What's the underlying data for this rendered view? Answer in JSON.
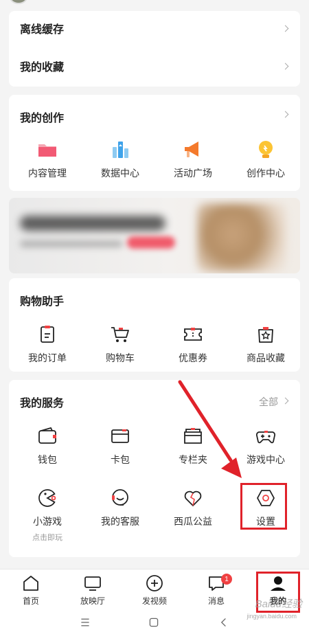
{
  "list_card": {
    "offline_cache": "离线缓存",
    "favorites": "我的收藏"
  },
  "creation": {
    "title": "我的创作",
    "items": [
      {
        "label": "内容管理",
        "icon": "folder-icon"
      },
      {
        "label": "数据中心",
        "icon": "bar-chart-icon"
      },
      {
        "label": "活动广场",
        "icon": "megaphone-icon"
      },
      {
        "label": "创作中心",
        "icon": "lightbulb-icon"
      }
    ]
  },
  "shopping": {
    "title": "购物助手",
    "items": [
      {
        "label": "我的订单",
        "icon": "order-icon"
      },
      {
        "label": "购物车",
        "icon": "cart-icon"
      },
      {
        "label": "优惠券",
        "icon": "coupon-icon"
      },
      {
        "label": "商品收藏",
        "icon": "bag-star-icon"
      }
    ]
  },
  "services": {
    "title": "我的服务",
    "more": "全部",
    "items": [
      {
        "label": "钱包",
        "icon": "wallet-icon"
      },
      {
        "label": "卡包",
        "icon": "card-icon"
      },
      {
        "label": "专栏夹",
        "icon": "column-folder-icon"
      },
      {
        "label": "游戏中心",
        "icon": "gamepad-icon"
      },
      {
        "label": "小游戏",
        "sub": "点击即玩",
        "icon": "pacman-icon"
      },
      {
        "label": "我的客服",
        "icon": "headset-icon"
      },
      {
        "label": "西瓜公益",
        "icon": "heart-icon"
      },
      {
        "label": "设置",
        "icon": "settings-hexagon-icon"
      }
    ]
  },
  "tabbar": {
    "items": [
      {
        "label": "首页",
        "icon": "home-icon"
      },
      {
        "label": "放映厅",
        "icon": "tv-icon"
      },
      {
        "label": "发视频",
        "icon": "plus-circle-icon"
      },
      {
        "label": "消息",
        "icon": "message-icon",
        "badge": "1"
      },
      {
        "label": "我的",
        "icon": "profile-icon"
      }
    ]
  },
  "watermark": {
    "text": "Baidu经验",
    "sub": "jingyan.baidu.com"
  },
  "colors": {
    "accent_red": "#f04142",
    "highlight_red": "#e0222a",
    "card_bg": "#ffffff",
    "page_bg": "#f4f4f4"
  }
}
